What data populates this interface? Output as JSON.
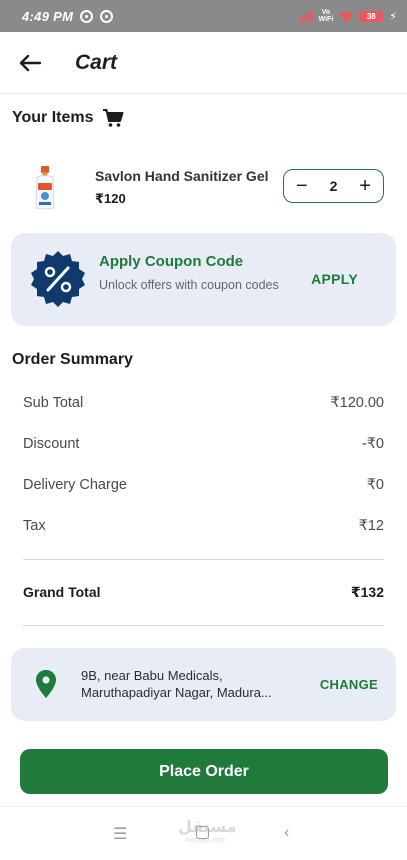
{
  "status_bar": {
    "time": "4:49 PM",
    "network_label_top": "Vo",
    "network_label_bottom": "WiFi",
    "battery": "38",
    "icons": [
      "app-notification-icon",
      "app-notification-icon",
      "signal-icon",
      "wifi-icon",
      "battery-icon",
      "charging-icon"
    ]
  },
  "header": {
    "title": "Cart",
    "back_icon": "arrow-left-icon"
  },
  "items_section": {
    "title": "Your Items",
    "icon": "cart-icon",
    "items": [
      {
        "name": "Savlon Hand Sanitizer Gel",
        "price": "₹120",
        "quantity": "2",
        "minus": "−",
        "plus": "+"
      }
    ]
  },
  "coupon": {
    "title": "Apply Coupon Code",
    "subtitle": "Unlock offers with coupon codes",
    "action": "APPLY",
    "icon": "percent-badge-icon"
  },
  "summary": {
    "title": "Order Summary",
    "rows": [
      {
        "label": "Sub Total",
        "value": "₹120.00"
      },
      {
        "label": "Discount",
        "value": "-₹0"
      },
      {
        "label": "Delivery Charge",
        "value": "₹0"
      },
      {
        "label": "Tax",
        "value": "₹12"
      }
    ],
    "grand_total": {
      "label": "Grand Total",
      "value": "₹132"
    }
  },
  "address": {
    "line1": "9B, near Babu Medicals,",
    "line2": "Maruthapadiyar Nagar, Madura...",
    "action": "CHANGE",
    "icon": "location-pin-icon"
  },
  "place_order": {
    "label": "Place Order"
  },
  "nav_bar": {
    "icons": [
      "menu-icon",
      "home-icon",
      "back-icon"
    ],
    "watermark": "مستقل",
    "watermark_sub": "mostaql.com"
  },
  "colors": {
    "primary_green": "#1f7a3c",
    "card_background": "#e8edf5",
    "coupon_badge": "#0f3a6e",
    "status_bar": "#8a8a8a"
  }
}
